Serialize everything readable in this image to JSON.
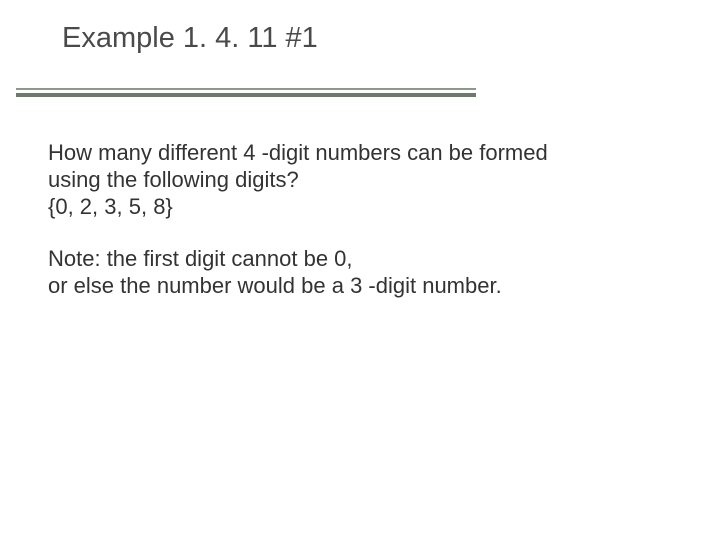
{
  "title": "Example 1. 4. 11 #1",
  "body": {
    "p1_l1": "How many different 4 -digit numbers can be formed",
    "p1_l2": "using the following digits?",
    "p1_l3": "{0, 2, 3, 5, 8}",
    "p2_l1": "Note: the first digit cannot be 0,",
    "p2_l2": "or else the number would be a 3 -digit number."
  }
}
